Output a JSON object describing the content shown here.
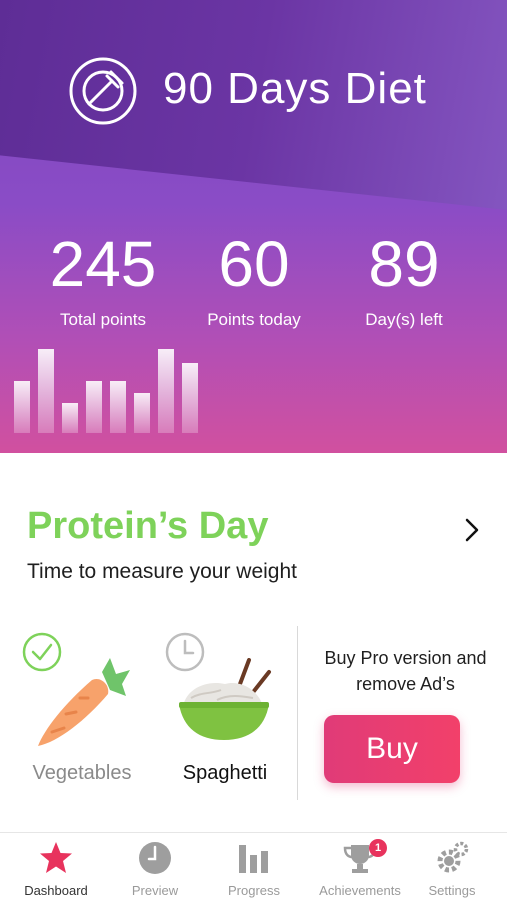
{
  "app": {
    "title": "90 Days Diet",
    "logo_icon": "plate-fork-icon"
  },
  "stats": [
    {
      "value": "245",
      "label": "Total points"
    },
    {
      "value": "60",
      "label": "Points today"
    },
    {
      "value": "89",
      "label": "Day(s) left"
    }
  ],
  "day_card": {
    "title": "Protein’s Day",
    "subtitle": "Time to measure your weight",
    "title_color": "#7ed25a"
  },
  "foods": [
    {
      "label": "Vegetables",
      "status_icon": "check-circle-icon",
      "icon": "carrot-icon"
    },
    {
      "label": "Spaghetti",
      "status_icon": "clock-icon",
      "icon": "noodle-bowl-icon"
    }
  ],
  "promo": {
    "text": "Buy Pro version and remove Ad’s",
    "button_label": "Buy"
  },
  "tabs": [
    {
      "label": "Dashboard",
      "icon": "star-icon",
      "active": true
    },
    {
      "label": "Preview",
      "icon": "clock-icon"
    },
    {
      "label": "Progress",
      "icon": "bar-chart-icon"
    },
    {
      "label": "Achievements",
      "icon": "trophy-icon",
      "badge": "1"
    },
    {
      "label": "Settings",
      "icon": "gear-icon"
    }
  ],
  "colors": {
    "accent_pink": "#e8335d",
    "purple": "#7c46bd",
    "green": "#7ed25a"
  }
}
